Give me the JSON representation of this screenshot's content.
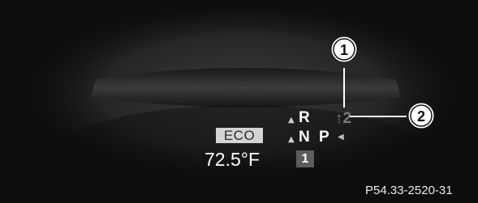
{
  "display": {
    "eco_label": "ECO",
    "temperature": "72.5°F",
    "gear_box_value": "1",
    "gear_indicator": "↑2",
    "selector": {
      "r": "R",
      "n": "N",
      "p": "P"
    },
    "reference_code": "P54.33-2520-31"
  },
  "callouts": {
    "one": "1",
    "two": "2"
  },
  "colors": {
    "background": "#0d0d0d",
    "eco_background": "#d4d4d4",
    "gear_box_background": "#5c5c5c",
    "gear_indicator": "#7a7a7a"
  }
}
